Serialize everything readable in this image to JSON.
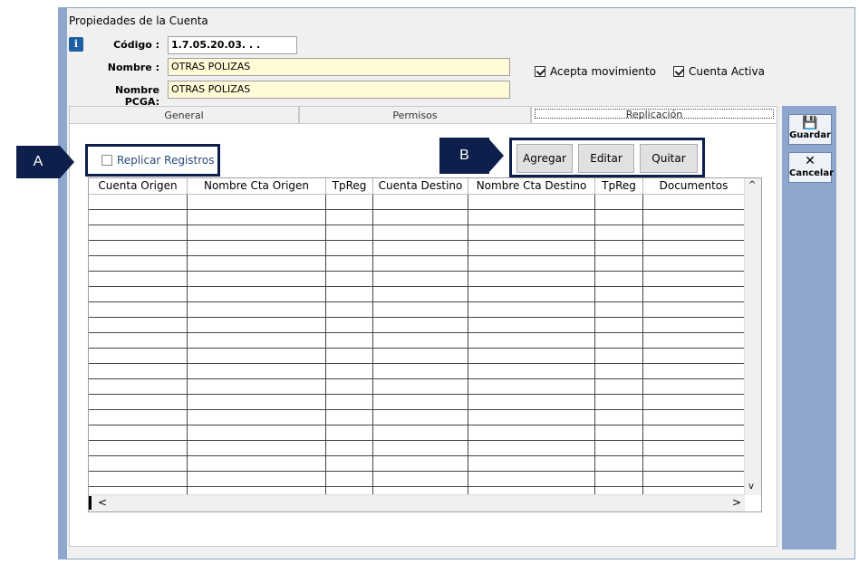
{
  "window": {
    "title": "Propiedades de la Cuenta"
  },
  "form": {
    "codigo_label": "Código :",
    "codigo_value": "1.7.05.20.03. . .",
    "nombre_label": "Nombre :",
    "nombre_value": "OTRAS POLIZAS",
    "pcga_label": "Nombre PCGA:",
    "pcga_value": "OTRAS POLIZAS",
    "acepta_movimiento": "Acepta movimiento",
    "cuenta_activa": "Cuenta Activa"
  },
  "tabs": [
    {
      "label": "General"
    },
    {
      "label": "Permisos"
    },
    {
      "label": "Replicación"
    }
  ],
  "replicacion": {
    "replicar_label": "Replicar Registros",
    "agregar": "Agregar",
    "editar": "Editar",
    "quitar": "Quitar"
  },
  "grid": {
    "columns": [
      "Cuenta Origen",
      "Nombre Cta Origen",
      "TpReg",
      "Cuenta Destino",
      "Nombre Cta Destino",
      "TpReg",
      "Documentos"
    ],
    "scroll_up": "^",
    "scroll_down": "v",
    "scroll_left": "<",
    "scroll_right": ">"
  },
  "sidebar": {
    "guardar": "Guardar",
    "cancelar": "Cancelar",
    "guardar_icon": "💾",
    "cancelar_icon": "✕"
  },
  "callouts": {
    "a": "A",
    "b": "B"
  },
  "colors": {
    "callout": "#0d1f4a",
    "sidebar": "#8fa7cf",
    "field_yellow": "#fffbd6"
  }
}
